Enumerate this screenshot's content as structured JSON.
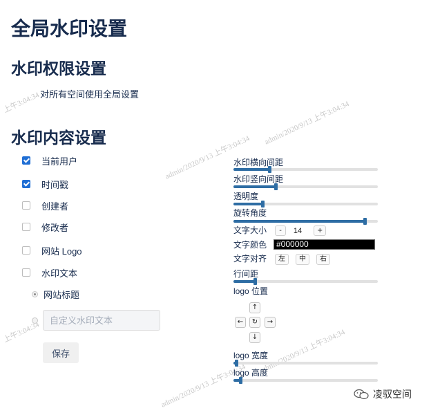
{
  "page": {
    "title": "全局水印设置",
    "permission_heading": "水印权限设置",
    "permission_text": "对所有空间使用全局设置",
    "content_heading": "水印内容设置"
  },
  "content_options": [
    {
      "label": "当前用户",
      "checked": true
    },
    {
      "label": "时间戳",
      "checked": true
    },
    {
      "label": "创建者",
      "checked": false
    },
    {
      "label": "修改者",
      "checked": false
    },
    {
      "label": "网站 Logo",
      "checked": false
    },
    {
      "label": "水印文本",
      "checked": false
    }
  ],
  "text_source": {
    "site_title_label": "网站标题",
    "site_title_selected": true,
    "custom_placeholder": "自定义水印文本"
  },
  "save_label": "保存",
  "settings": {
    "horizontal_spacing": {
      "label": "水印横向间距",
      "value": 0.25
    },
    "vertical_spacing": {
      "label": "水印竖向间距",
      "value": 0.29
    },
    "opacity": {
      "label": "透明度",
      "value": 0.2
    },
    "rotation": {
      "label": "旋转角度",
      "value": 0.91
    },
    "font_size": {
      "label": "文字大小",
      "minus": "-",
      "value": "14",
      "plus": "+"
    },
    "text_color": {
      "label": "文字颜色",
      "value": "#000000"
    },
    "text_align": {
      "label": "文字对齐",
      "options": [
        "左",
        "中",
        "右"
      ]
    },
    "line_spacing": {
      "label": "行间距",
      "value": 0.15
    },
    "logo_position": {
      "label": "logo 位置",
      "up": "↑",
      "left": "←",
      "center": "↻",
      "right": "→",
      "down": "↓"
    },
    "logo_width": {
      "label": "logo 宽度",
      "value": 0.02
    },
    "logo_height": {
      "label": "logo 高度",
      "value": 0.05
    }
  },
  "watermark_samples": [
    "上午3:04:34",
    "admin/2020/9/13 上午3:04:34",
    "admin/2020/9/13 上午3:04:34",
    "上午3:04:34",
    "admin/2020/9/13 上午3:04:34",
    "admin/2020/9/13 上午3:04:34"
  ],
  "footer": {
    "brand": "凌驭空间"
  },
  "colors": {
    "accent": "#1f6ed4",
    "slider": "#2e6da4",
    "heading": "#172b4d"
  }
}
